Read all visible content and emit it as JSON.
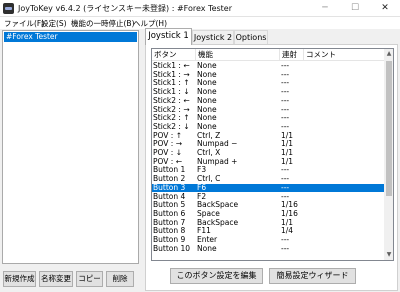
{
  "window": {
    "title": "JoyToKey v6.4.2 (ライセンスキー未登録) : #Forex Tester",
    "min": "─",
    "max": "☐",
    "close": "✕"
  },
  "menu": [
    "ファイル(F)",
    "設定(S)",
    "機能の一時停止(B)",
    "ヘルプ(H)"
  ],
  "profiles": {
    "items": [
      "#Forex Tester"
    ],
    "buttons": [
      "新規作成",
      "名称変更",
      "コピー",
      "削除"
    ]
  },
  "tabs": [
    "Joystick 1",
    "Joystick 2",
    "Options"
  ],
  "table": {
    "headers": [
      "ボタン",
      "機能",
      "連射",
      "コメント"
    ],
    "rows": [
      [
        "Stick1 : ←",
        "None",
        "---"
      ],
      [
        "Stick1 : →",
        "None",
        "---"
      ],
      [
        "Stick1 : ↑",
        "None",
        "---"
      ],
      [
        "Stick1 : ↓",
        "None",
        "---"
      ],
      [
        "Stick2 : ←",
        "None",
        "---"
      ],
      [
        "Stick2 : →",
        "None",
        "---"
      ],
      [
        "Stick2 : ↑",
        "None",
        "---"
      ],
      [
        "Stick2 : ↓",
        "None",
        "---"
      ],
      [
        "POV : ↑",
        "Ctrl, Z",
        "1/1"
      ],
      [
        "POV : →",
        "Numpad −",
        "1/1"
      ],
      [
        "POV : ↓",
        "Ctrl, X",
        "1/1"
      ],
      [
        "POV : ←",
        "Numpad +",
        "1/1"
      ],
      [
        "Button 1",
        "F3",
        "---"
      ],
      [
        "Button 2",
        "Ctrl, C",
        "---"
      ],
      [
        "Button 3",
        "F6",
        "---"
      ],
      [
        "Button 4",
        "F2",
        "---"
      ],
      [
        "Button 5",
        "BackSpace",
        "1/16"
      ],
      [
        "Button 6",
        "Space",
        "1/16"
      ],
      [
        "Button 7",
        "BackSpace",
        "1/1"
      ],
      [
        "Button 8",
        "F11",
        "1/4"
      ],
      [
        "Button 9",
        "Enter",
        "---"
      ],
      [
        "Button 10",
        "None",
        "---"
      ]
    ],
    "selected_row": 14
  },
  "actions": {
    "edit_label": "このボタン設定を編集",
    "wizard_label": "簡易設定ウィザード"
  },
  "colors": {
    "selection": "#0078d7"
  }
}
